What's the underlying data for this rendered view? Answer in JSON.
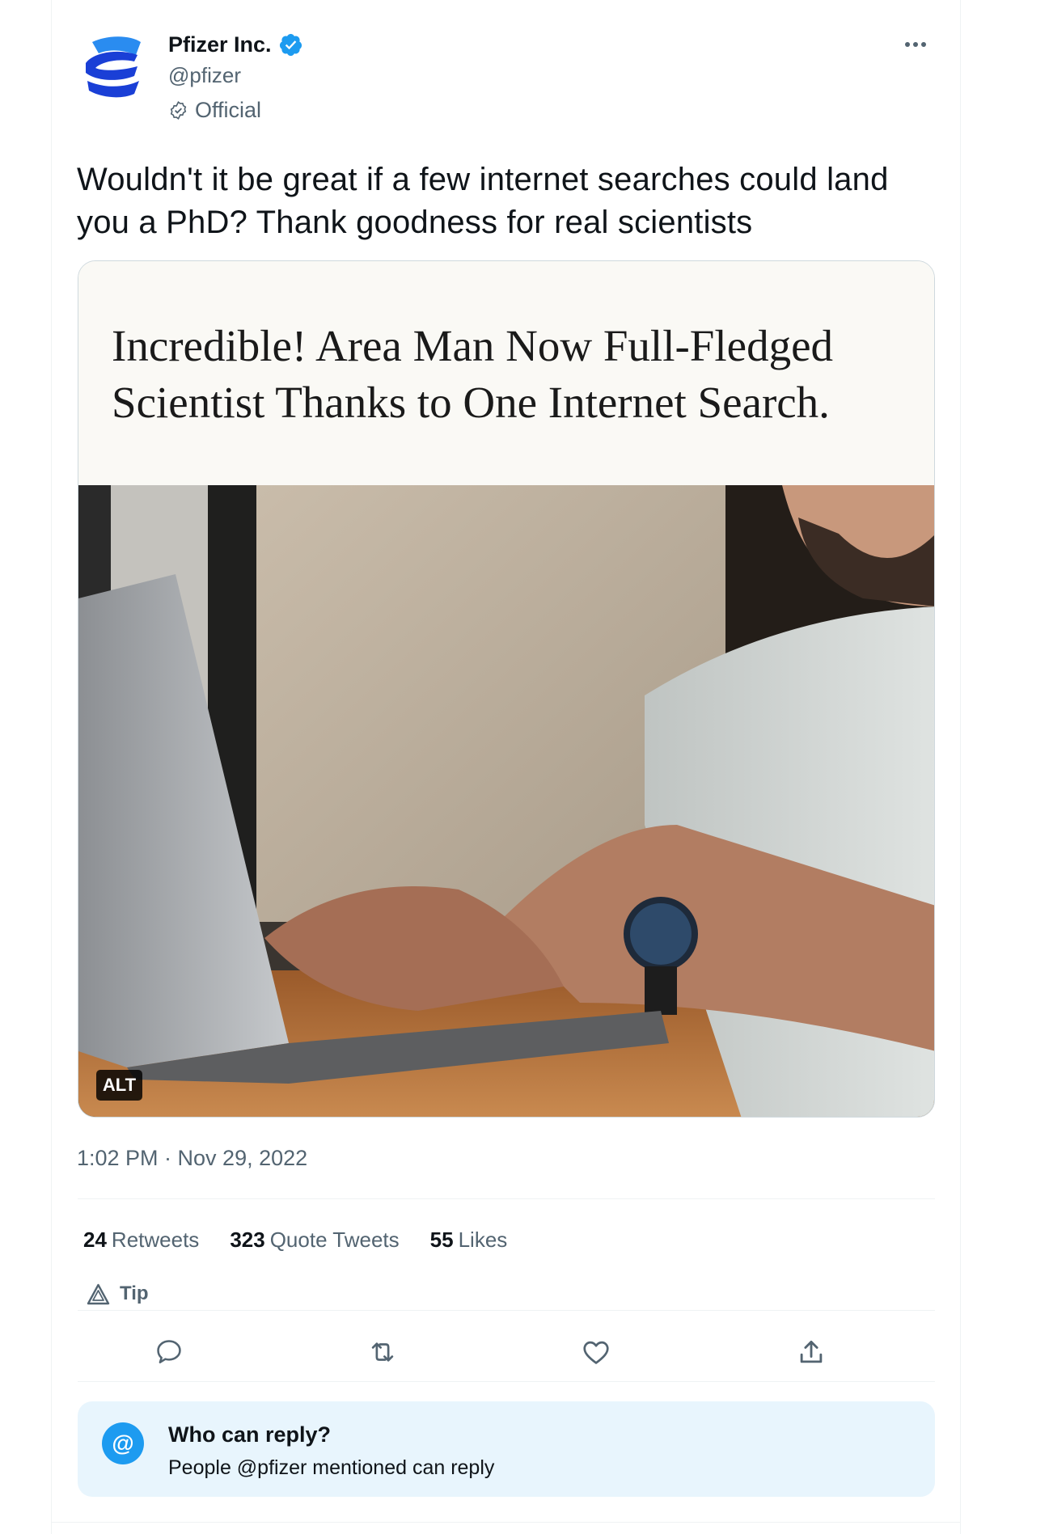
{
  "author": {
    "display_name": "Pfizer Inc.",
    "handle": "@pfizer",
    "label": "Official",
    "verified": true,
    "verified_color": "#1d9bf0",
    "logo_colors": [
      "#1a3fd6",
      "#2a8cf0"
    ]
  },
  "tweet": {
    "text": "Wouldn't it be great if a few internet searches could land you a PhD? Thank goodness for real scientists",
    "timestamp": "1:02 PM · Nov 29, 2022"
  },
  "media": {
    "headline": "Incredible! Area Man Now Full-Fledged Scientist Thanks to One Internet Search.",
    "alt_badge": "ALT"
  },
  "stats": [
    {
      "count": "24",
      "label": "Retweets"
    },
    {
      "count": "323",
      "label": "Quote Tweets"
    },
    {
      "count": "55",
      "label": "Likes"
    }
  ],
  "tip_label": "Tip",
  "actions": [
    "reply-icon",
    "retweet-icon",
    "like-icon",
    "share-icon"
  ],
  "who_can_reply": {
    "icon": "@",
    "title": "Who can reply?",
    "subtitle": "People @pfizer mentioned can reply"
  },
  "colors": {
    "accent": "#1d9bf0",
    "text_primary": "#0f1419",
    "text_secondary": "#536471",
    "reply_box_bg": "#e8f5fd"
  }
}
